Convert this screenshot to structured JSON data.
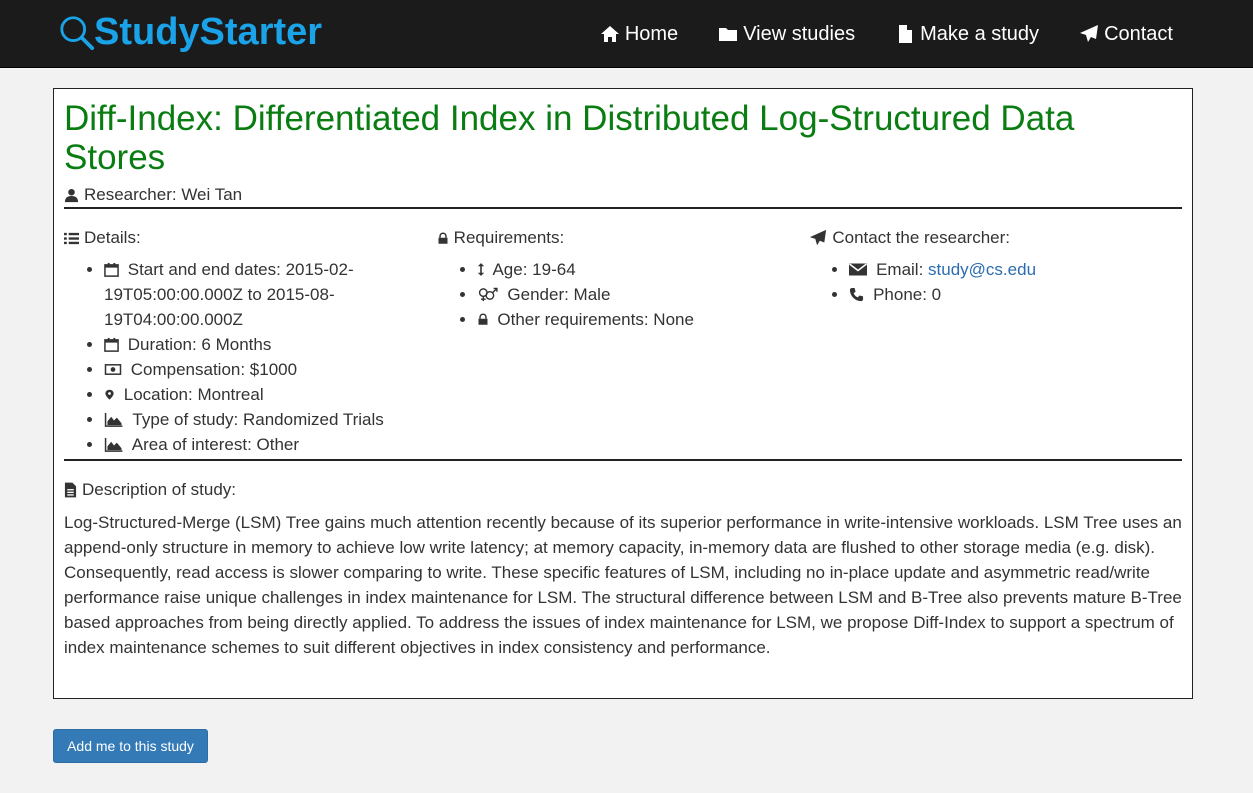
{
  "header": {
    "brand": "StudyStarter",
    "nav": [
      {
        "label": "Home",
        "icon": "home-icon"
      },
      {
        "label": "View studies",
        "icon": "folder-icon"
      },
      {
        "label": "Make a study",
        "icon": "file-icon"
      },
      {
        "label": "Contact",
        "icon": "paper-plane-icon"
      }
    ]
  },
  "study": {
    "title": "Diff-Index: Differentiated Index in Distributed Log-Structured Data Stores",
    "researcher": "Researcher: Wei Tan",
    "details": {
      "heading": "Details:",
      "dates": "Start and end dates: 2015-02-19T05:00:00.000Z to 2015-08-19T04:00:00.000Z",
      "duration": "Duration: 6 Months",
      "compensation": "Compensation: $1000",
      "location": "Location: Montreal",
      "type": "Type of study: Randomized Trials",
      "area": "Area of interest: Other"
    },
    "requirements": {
      "heading": "Requirements:",
      "age": "Age: 19-64",
      "gender": "Gender: Male",
      "other": "Other requirements: None"
    },
    "contact": {
      "heading": "Contact the researcher:",
      "email_label": "Email: ",
      "email": "study@cs.edu",
      "phone": "Phone: 0"
    },
    "description": {
      "heading": "Description of study:",
      "body": "Log-Structured-Merge (LSM) Tree gains much attention recently because of its superior performance in write-intensive workloads. LSM Tree uses an append-only structure in memory to achieve low write latency; at memory capacity, in-memory data are flushed to other storage media (e.g. disk). Consequently, read access is slower comparing to write. These specific features of LSM, including no in-place update and asymmetric read/write performance raise unique challenges in index maintenance for LSM. The structural difference between LSM and B-Tree also prevents mature B-Tree based approaches from being directly applied. To address the issues of index maintenance for LSM, we propose Diff-Index to support a spectrum of index maintenance schemes to suit different objectives in index consistency and performance."
    }
  },
  "actions": {
    "join_label": "Add me to this study"
  },
  "colors": {
    "navbar": "#1b1b1b",
    "brand": "#1aa3e8",
    "title": "#0a7d12",
    "link": "#2b6cb0",
    "button": "#337ab7"
  }
}
